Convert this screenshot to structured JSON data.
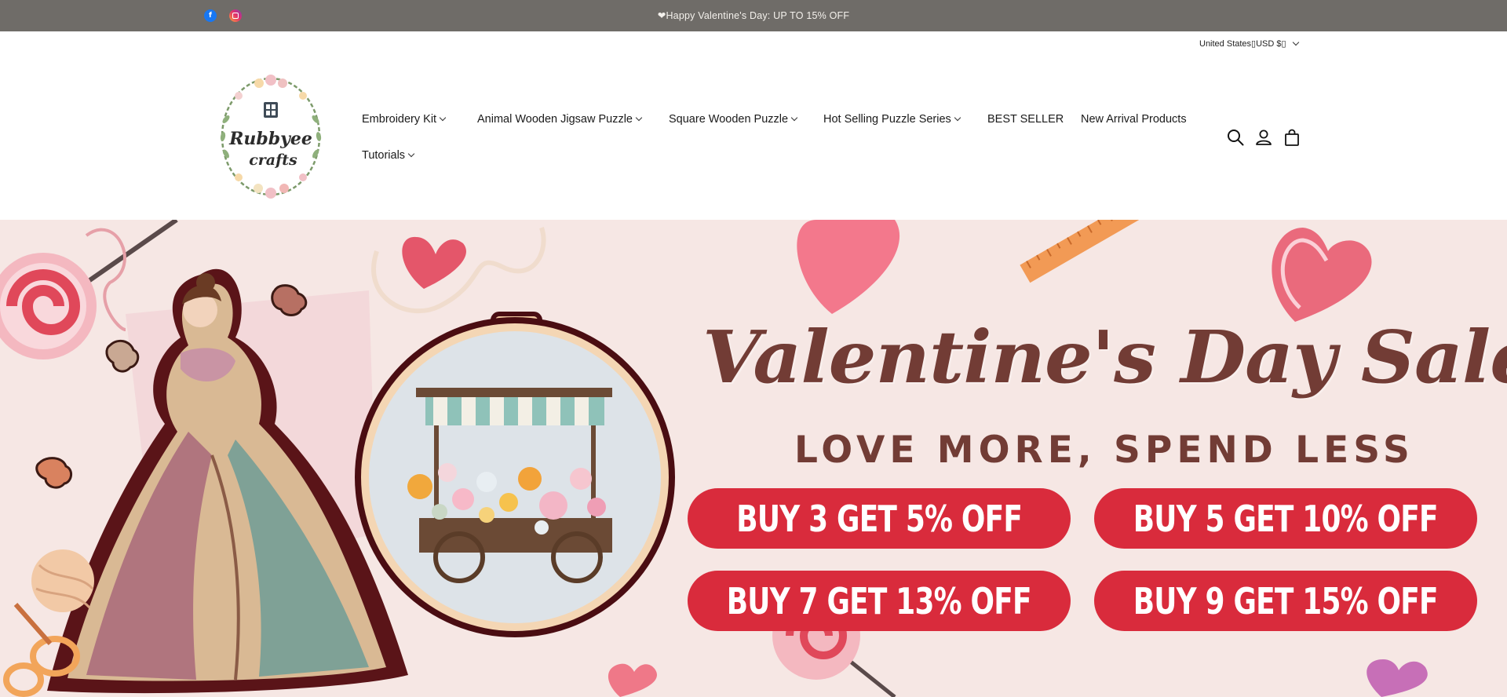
{
  "announcement": {
    "text": "❤Happy Valentine's Day: UP TO 15% OFF",
    "social": [
      {
        "name": "facebook",
        "glyph": "f"
      },
      {
        "name": "instagram"
      }
    ]
  },
  "header": {
    "locale_label": "United States▯USD $▯",
    "logo_text": [
      "Rubbyee",
      "crafts"
    ],
    "nav": [
      {
        "label": "Embroidery Kit",
        "has_dropdown": true
      },
      {
        "label": "Animal Wooden Jigsaw Puzzle",
        "has_dropdown": true
      },
      {
        "label": "Square Wooden Puzzle",
        "has_dropdown": true
      },
      {
        "label": "Hot Selling Puzzle Series",
        "has_dropdown": true
      },
      {
        "label": "BEST SELLER",
        "has_dropdown": false
      },
      {
        "label": "New Arrival Products",
        "has_dropdown": false
      },
      {
        "label": "Tutorials",
        "has_dropdown": true
      }
    ],
    "icons": [
      "search-icon",
      "account-icon",
      "cart-icon"
    ]
  },
  "banner": {
    "title": "Valentine's Day Sale",
    "subtitle": "LOVE MORE, SPEND LESS",
    "offers": [
      "BUY 3 GET 5% OFF",
      "BUY 5 GET 10% OFF",
      "BUY 7 GET 13% OFF",
      "BUY 9 GET 15% OFF"
    ],
    "colors": {
      "background": "#f6e7e4",
      "title": "#723c35",
      "offer_pill": "#d92b3c",
      "announcement_bar": "#6f6c68"
    }
  }
}
